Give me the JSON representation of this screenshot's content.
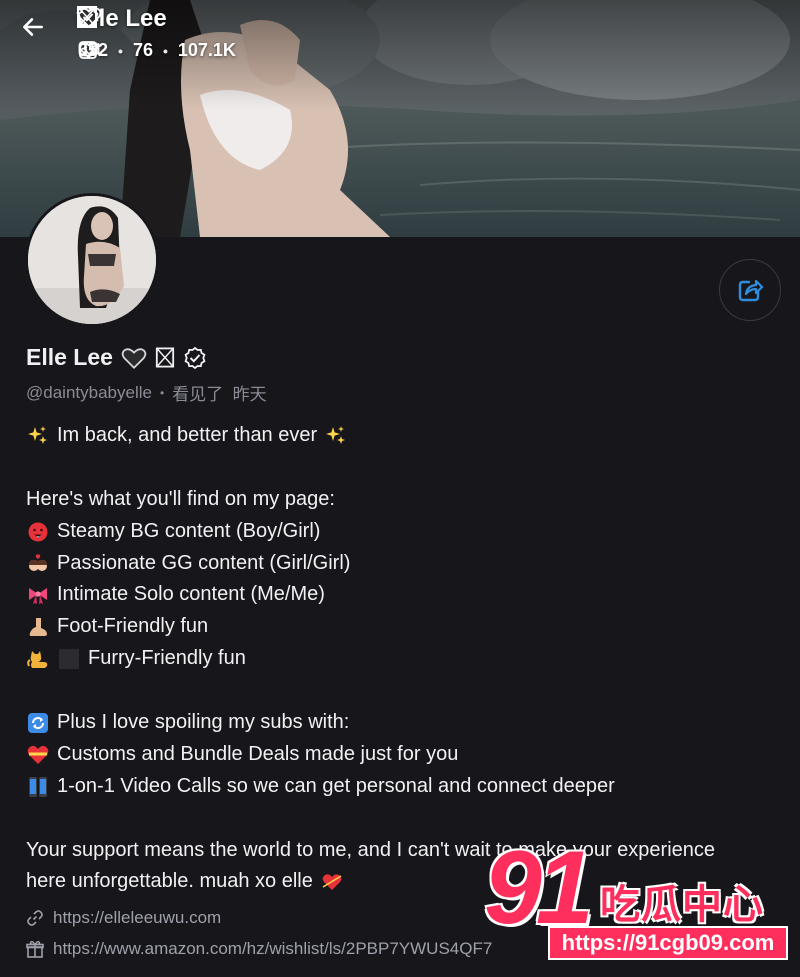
{
  "header": {
    "title": "Elle Lee",
    "stats": {
      "photos": "652",
      "videos": "76",
      "likes": "107.1K"
    }
  },
  "profile": {
    "name": "Elle Lee",
    "handle": "@daintybabyelle",
    "last_seen": "看见了  昨天"
  },
  "bio": {
    "line1": "Im back, and better than ever",
    "line2": "Here's what you'll find on my page:",
    "line3": "Steamy BG content (Boy/Girl)",
    "line4": "Passionate GG content (Girl/Girl)",
    "line5": "Intimate Solo content (Me/Me)",
    "line6": "Foot-Friendly fun",
    "line7": "Furry-Friendly fun",
    "line8": "Plus I love spoiling my subs with:",
    "line9": "Customs and Bundle Deals made just for you",
    "line10": "1-on-1 Video Calls so we can get personal and connect deeper",
    "line11": "Your support means the world to me, and I can't wait to make your experience",
    "line12": "here unforgettable. muah xo elle"
  },
  "links": {
    "website": "https://elleleeuwu.com",
    "wishlist": "https://www.amazon.com/hz/wishlist/ls/2PBP7YWUS4QF7"
  },
  "watermark": {
    "number": "91",
    "brand": "吃瓜中心",
    "url": "https://91cgb09.com"
  },
  "colors": {
    "background": "#17171b",
    "text": "#f1f1f4",
    "muted": "#8a8b95",
    "accent": "#2d8ee0",
    "watermark": "#ff2f5d"
  }
}
